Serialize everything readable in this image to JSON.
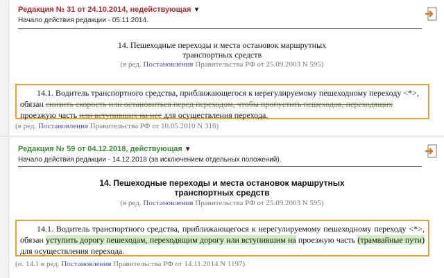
{
  "old": {
    "edition_title": "Редакция № 31 от 24.10.2014, недействующая",
    "edition_start": "Начало действия редакции - 05.11.2014.",
    "article_title_l1": "14. Пешеходные переходы и места остановок маршрутных",
    "article_title_l2": "транспортных средств",
    "art_red": {
      "prefix": "(в ред. ",
      "link": "Постановления",
      "suffix": " Правительства РФ от 25.09.2003 N 595)"
    },
    "para": {
      "t1": "14.1. Водитель транспортного средства, приближающегося к нерегулируемому пешеходному переходу <*>, обязан ",
      "d1": "снизить скорость или остановиться перед переходом, чтобы пропустить пешеходов, переходящих",
      "t2": " проезжую часть ",
      "d2": "или вступивших на нее",
      "t3": " для осуществления перехода."
    },
    "para_red": {
      "prefix": "(в ред. ",
      "link": "Постановления",
      "suffix": " Правительства РФ от 10.05.2010 N 316)"
    }
  },
  "new": {
    "edition_title": "Редакция № 59 от 04.12.2018, действующая",
    "edition_start": "Начало действия редакции - 14.12.2018 (за исключением отдельных положений).",
    "article_title_l1": "14. Пешеходные переходы и места остановок маршрутных",
    "article_title_l2": "транспортных средств",
    "art_red": {
      "prefix": "(в ред. ",
      "link": "Постановления",
      "suffix": " Правительства РФ от 25.09.2003 N 595)"
    },
    "para": {
      "t1": "14.1. Водитель транспортного средства, приближающегося к нерегулируемому пешеходному переходу <*>, обязан ",
      "i1": "уступить дорогу пешеходам, переходящим дорогу или вступившим на",
      "t2": " проезжую часть ",
      "i2": "(трамвайные пути)",
      "t3": " для осуществления перехода."
    },
    "para_red": {
      "prefix": "(п. 14.1 в ред. ",
      "link": "Постановления",
      "suffix": " Правительства РФ от 14.11.2014 N 1197)"
    }
  },
  "icons": {
    "exit": "exit-document-icon",
    "dropdown": "triangle-down-icon"
  },
  "colors": {
    "old_edition": "#b0252d",
    "new_edition": "#3a8a3a",
    "highlight_border": "#f0a030",
    "inserted_bg": "#d2ecc4",
    "link": "#4a4ab5"
  }
}
